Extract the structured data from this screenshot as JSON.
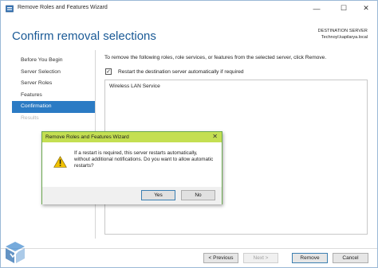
{
  "window": {
    "title": "Remove Roles and Features Wizard",
    "minimize_glyph": "—",
    "maximize_glyph": "☐",
    "close_glyph": "✕"
  },
  "header": {
    "title": "Confirm removal selections",
    "destination_label": "DESTINATION SERVER",
    "destination_value": "Technoyl.kapilarya.local"
  },
  "nav": {
    "items": [
      {
        "label": "Before You Begin",
        "state": "normal"
      },
      {
        "label": "Server Selection",
        "state": "normal"
      },
      {
        "label": "Server Roles",
        "state": "normal"
      },
      {
        "label": "Features",
        "state": "normal"
      },
      {
        "label": "Confirmation",
        "state": "active"
      },
      {
        "label": "Results",
        "state": "disabled"
      }
    ]
  },
  "main": {
    "description": "To remove the following roles, role services, or features from the selected server, click Remove.",
    "restart_checkbox": {
      "label": "Restart the destination server automatically if required",
      "checked": true,
      "glyph": "✓"
    },
    "items": [
      "Wireless LAN Service"
    ]
  },
  "footer": {
    "previous_label": "< Previous",
    "next_label": "Next >",
    "remove_label": "Remove",
    "cancel_label": "Cancel"
  },
  "dialog": {
    "title": "Remove Roles and Features Wizard",
    "close_glyph": "✕",
    "icon": "warning-icon",
    "message": "If a restart is required, this server restarts automatically, without additional notifications. Do you want to allow automatic restarts?",
    "yes_label": "Yes",
    "no_label": "No"
  },
  "colors": {
    "accent": "#2b7bc4",
    "title_blue": "#1a5a96",
    "dialog_titlebar": "#c4df52",
    "warning": "#f2c200"
  }
}
